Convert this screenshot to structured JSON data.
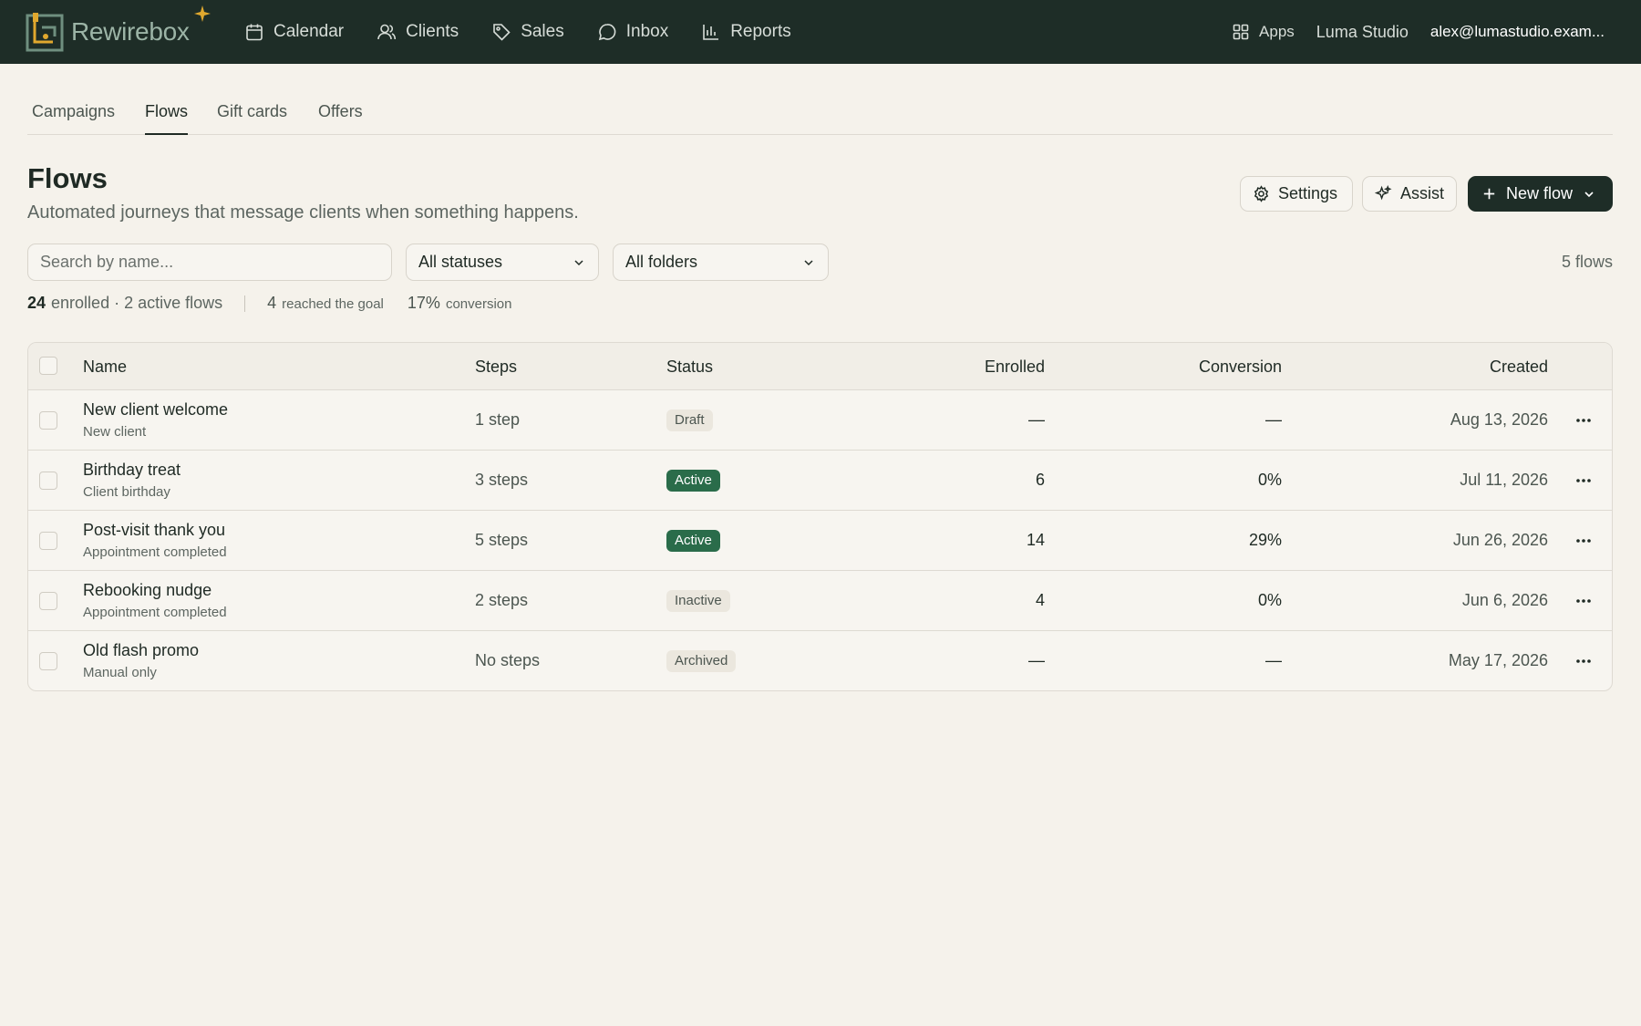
{
  "app": {
    "logo_text": "Rewirebox",
    "nav": [
      {
        "label": "Calendar",
        "icon": "calendar-icon"
      },
      {
        "label": "Clients",
        "icon": "users-icon"
      },
      {
        "label": "Sales",
        "icon": "tag-icon"
      },
      {
        "label": "Inbox",
        "icon": "chat-bubble-icon"
      },
      {
        "label": "Reports",
        "icon": "bar-chart-icon"
      }
    ],
    "apps_label": "Apps",
    "studio_label": "Luma Studio",
    "user_email": "alex@lumastudio.exam..."
  },
  "tabs": [
    "Campaigns",
    "Flows",
    "Gift cards",
    "Offers"
  ],
  "active_tab": "Flows",
  "header": {
    "title": "Flows",
    "subtitle": "Automated journeys that message clients when something happens.",
    "settings_label": "Settings",
    "assist_label": "Assist",
    "new_flow_label": "New flow"
  },
  "filters": {
    "search_placeholder": "Search by name...",
    "status_value": "All statuses",
    "folder_value": "All folders",
    "count_label": "5 flows"
  },
  "stats": {
    "enrolled_num": "24",
    "enrolled_text": "enrolled · 2 active flows",
    "goal_num": "4",
    "goal_text": "reached the goal",
    "conversion_num": "17%",
    "conversion_text": "conversion"
  },
  "table": {
    "columns": [
      "Name",
      "Steps",
      "Status",
      "Enrolled",
      "Conversion",
      "Created"
    ],
    "rows": [
      {
        "name": "New client welcome",
        "trigger": "New client",
        "steps": "1 step",
        "status": "Draft",
        "enrolled": "—",
        "conversion": "—",
        "created": "Aug 13, 2026"
      },
      {
        "name": "Birthday treat",
        "trigger": "Client birthday",
        "steps": "3 steps",
        "status": "Active",
        "enrolled": "6",
        "conversion": "0%",
        "created": "Jul 11, 2026"
      },
      {
        "name": "Post-visit thank you",
        "trigger": "Appointment completed",
        "steps": "5 steps",
        "status": "Active",
        "enrolled": "14",
        "conversion": "29%",
        "created": "Jun 26, 2026"
      },
      {
        "name": "Rebooking nudge",
        "trigger": "Appointment completed",
        "steps": "2 steps",
        "status": "Inactive",
        "enrolled": "4",
        "conversion": "0%",
        "created": "Jun 6, 2026"
      },
      {
        "name": "Old flash promo",
        "trigger": "Manual only",
        "steps": "No steps",
        "status": "Archived",
        "enrolled": "—",
        "conversion": "—",
        "created": "May 17, 2026"
      }
    ]
  },
  "colors": {
    "topbar": "#1e2d27",
    "background": "#f5f2eb",
    "active_badge": "#2a6c4a",
    "logo_accent": "#e0a82e"
  }
}
